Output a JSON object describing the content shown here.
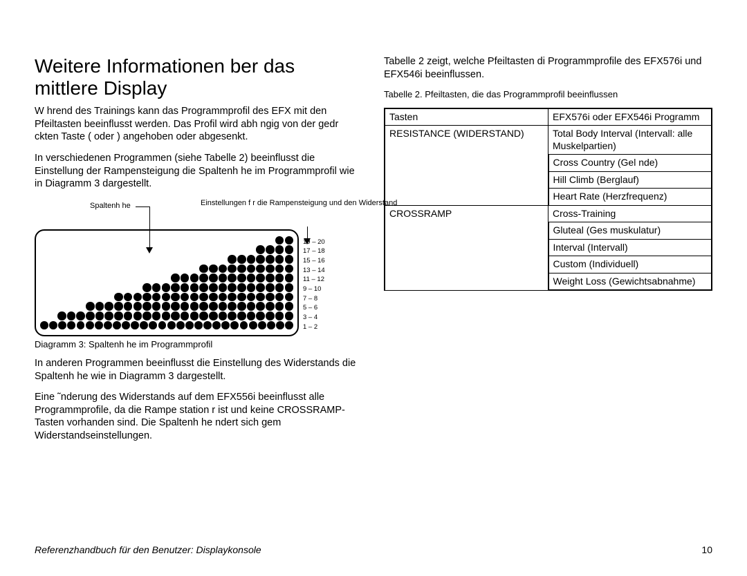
{
  "title": "Weitere Informationen ber das mittlere Display",
  "left": {
    "p1": "W hrend des Trainings kann das Programmprofil des EFX mit den Pfeiltasten beeinflusst werden. Das Profil wird abh ngig von der gedr ckten Taste (   oder   ) angehoben oder abgesenkt.",
    "p2": "In verschiedenen Programmen (siehe Tabelle 2) beeinflusst die Einstellung der Rampensteigung die Spaltenh he im Programmprofil wie in Diagramm 3 dargestellt.",
    "label_left": "Spaltenh he",
    "label_right": "Einstellungen f r die Rampensteigung und den Widerstand",
    "caption": "Diagramm 3: Spaltenh he im Programmprofil",
    "p3": "In anderen Programmen beeinflusst die Einstellung des Widerstands die Spaltenh he wie in Diagramm 3 dargestellt.",
    "p4": "Eine ˜nderung des Widerstands auf dem EFX556i beeinflusst alle Programmprofile, da die Rampe station r ist und keine CROSSRAMP-Tasten vorhanden sind. Die Spaltenh he  ndert sich gem  Widerstandseinstellungen.",
    "scale": [
      "19 – 20",
      "17 – 18",
      "15 – 16",
      "13 – 14",
      "11 – 12",
      "9 – 10",
      "7 – 8",
      "5 – 6",
      "3 – 4",
      "1 – 2"
    ],
    "rows": [
      2,
      4,
      7,
      10,
      13,
      16,
      19,
      22,
      25,
      28
    ]
  },
  "right": {
    "p1": "Tabelle 2 zeigt, welche Pfeiltasten di Programmprofile des EFX576i und EFX546i beeinflussen.",
    "table_caption": "Tabelle 2. Pfeiltasten, die das Programmprofil beeinflussen",
    "header": {
      "c1": "Tasten",
      "c2": "EFX576i oder EFX546i Programm"
    },
    "sections": [
      {
        "key": "RESISTANCE (WIDERSTAND)",
        "items": [
          "Total Body Interval (Intervall: alle Muskelpartien)",
          "Cross Country (Gel nde)",
          "Hill Climb (Berglauf)",
          "Heart Rate (Herzfrequenz)"
        ]
      },
      {
        "key": "CROSSRAMP",
        "items": [
          "Cross-Training",
          "Gluteal (Ges  muskulatur)",
          "Interval (Intervall)",
          "Custom (Individuell)",
          "Weight Loss (Gewichtsabnahme)"
        ]
      }
    ]
  },
  "footer": {
    "left": "Referenzhandbuch für den Benutzer: Displaykonsole",
    "page": "10"
  }
}
